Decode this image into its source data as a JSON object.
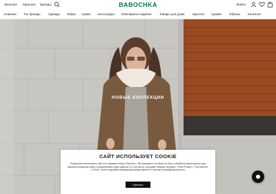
{
  "header": {
    "gender_links": [
      "Женское",
      "Мужское",
      "Бренды"
    ],
    "logo": "BABOCHKA",
    "login": "Войти"
  },
  "nav": {
    "items": [
      "Новинки",
      "Топ бренды",
      "Одежда",
      "Обувь",
      "Сумки",
      "Аксессуары",
      "Ювелирные изделия",
      "Товары для дома",
      "Красота",
      "Архиво",
      "Образы",
      "Каталоги"
    ]
  },
  "hero": {
    "title": "НОВЫЕ КОЛЛЕКЦИИ"
  },
  "cookie": {
    "title": "САЙТ ИСПОЛЬЗУЕТ COOKIE",
    "text": "Продолжая использовать сайт или нажимая кнопку «Принять», Вы выражаете согласие на сбор и обработку ваших данных для анализа посещения сайта с применением cookie-файлов и, в том числе, программ «Яндекс Метрика», «Рейл Роскет», «Top.Mail.Ru» и «Jivo». Более подробная информация представлена в Политике конфиденциальности",
    "accept_label": "Принять"
  },
  "icons": [
    "search-icon",
    "user-icon",
    "heart-icon",
    "bag-icon",
    "chat-icon"
  ],
  "colors": {
    "brand": "#0a7a3c",
    "button": "#111111"
  }
}
